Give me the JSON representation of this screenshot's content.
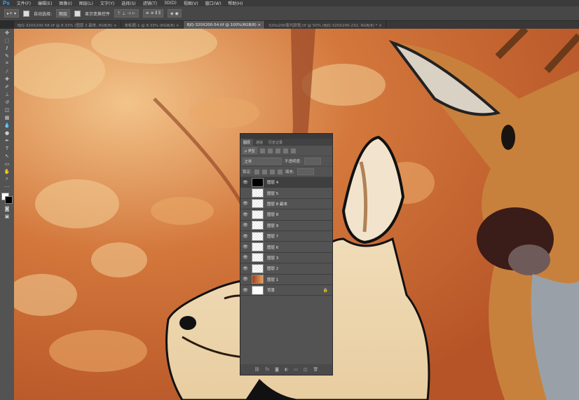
{
  "menubar": {
    "logo": "Ps",
    "items": [
      "文件(F)",
      "编辑(E)",
      "图像(I)",
      "图层(L)",
      "文字(Y)",
      "选择(S)",
      "滤镜(T)",
      "3D(D)",
      "视图(V)",
      "窗口(W)",
      "帮助(H)"
    ]
  },
  "options": {
    "auto_select": "自动选择:",
    "auto_select_value": "图层",
    "show_transform": "显示变换控件"
  },
  "tabs": [
    {
      "label": "BJQ-320X200-58.tif @ 8.33% (图层 2 副本, RGB/8) ×"
    },
    {
      "label": "未标题-1 @ 8.33% (RGB/8) ×"
    },
    {
      "label": "BJQ-320X200-54.tif @ 100%(RGB/8) ×"
    },
    {
      "label": "320x200笔代颜鬼.tif @ 50% (BJQ-320X200-232, RGB/8) * ×"
    }
  ],
  "layers_panel": {
    "tabs": [
      "图层",
      "通道",
      "历史记录"
    ],
    "kind_label": "ρ 类型",
    "blend_mode": "正常",
    "opacity_label": "不透明度:",
    "lock_label": "锁定:",
    "fill_label": "填充:",
    "layers": [
      {
        "name": "图层 4",
        "visible": true,
        "thumb": "black"
      },
      {
        "name": "图层 5",
        "visible": false,
        "thumb": "transparent"
      },
      {
        "name": "图层 8 副本",
        "visible": true,
        "thumb": "transparent"
      },
      {
        "name": "图层 8",
        "visible": true,
        "thumb": "transparent"
      },
      {
        "name": "图层 9",
        "visible": true,
        "thumb": "transparent"
      },
      {
        "name": "图层 7",
        "visible": true,
        "thumb": "transparent"
      },
      {
        "name": "图层 6",
        "visible": true,
        "thumb": "transparent"
      },
      {
        "name": "图层 3",
        "visible": true,
        "thumb": "transparent"
      },
      {
        "name": "图层 2",
        "visible": true,
        "thumb": "transparent"
      },
      {
        "name": "图层 1",
        "visible": true,
        "thumb": "photo"
      },
      {
        "name": "背景",
        "visible": true,
        "thumb": "white",
        "locked": true
      }
    ]
  },
  "colors": {
    "ui_dark": "#2b2b2b",
    "panel": "#535353",
    "canvas_orange": "#c2622d",
    "tab_active": "#5a5a5a"
  }
}
